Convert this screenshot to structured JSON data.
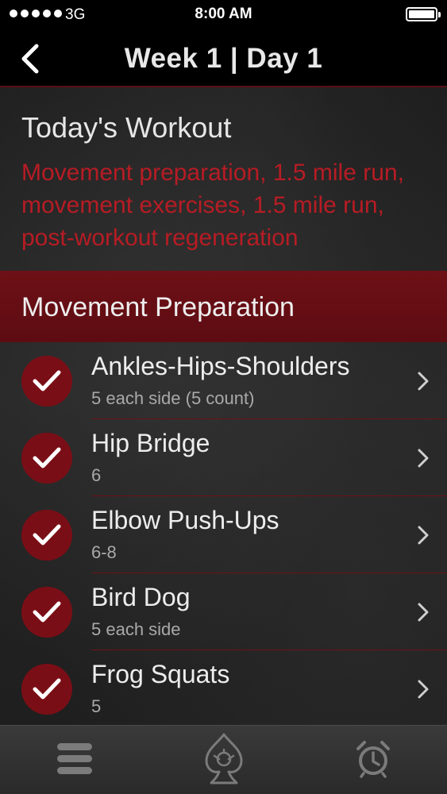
{
  "status_bar": {
    "carrier": "3G",
    "time": "8:00 AM"
  },
  "nav": {
    "title": "Week 1 | Day 1"
  },
  "workout": {
    "heading": "Today's Workout",
    "description": "Movement preparation, 1.5 mile run, movement exercises, 1.5 mile run, post-workout regeneration"
  },
  "section": {
    "title": "Movement Preparation"
  },
  "exercises": [
    {
      "name": "Ankles-Hips-Shoulders",
      "detail": "5 each side (5 count)"
    },
    {
      "name": "Hip Bridge",
      "detail": "6"
    },
    {
      "name": "Elbow Push-Ups",
      "detail": "6-8"
    },
    {
      "name": "Bird Dog",
      "detail": "5 each side"
    },
    {
      "name": "Frog Squats",
      "detail": "5"
    }
  ],
  "tabs": [
    {
      "icon": "menu-icon"
    },
    {
      "icon": "spade-emblem-icon"
    },
    {
      "icon": "alarm-clock-icon"
    }
  ],
  "colors": {
    "accent": "#b71c24",
    "band": "#6e1017",
    "check_circle": "#7a0e16"
  }
}
